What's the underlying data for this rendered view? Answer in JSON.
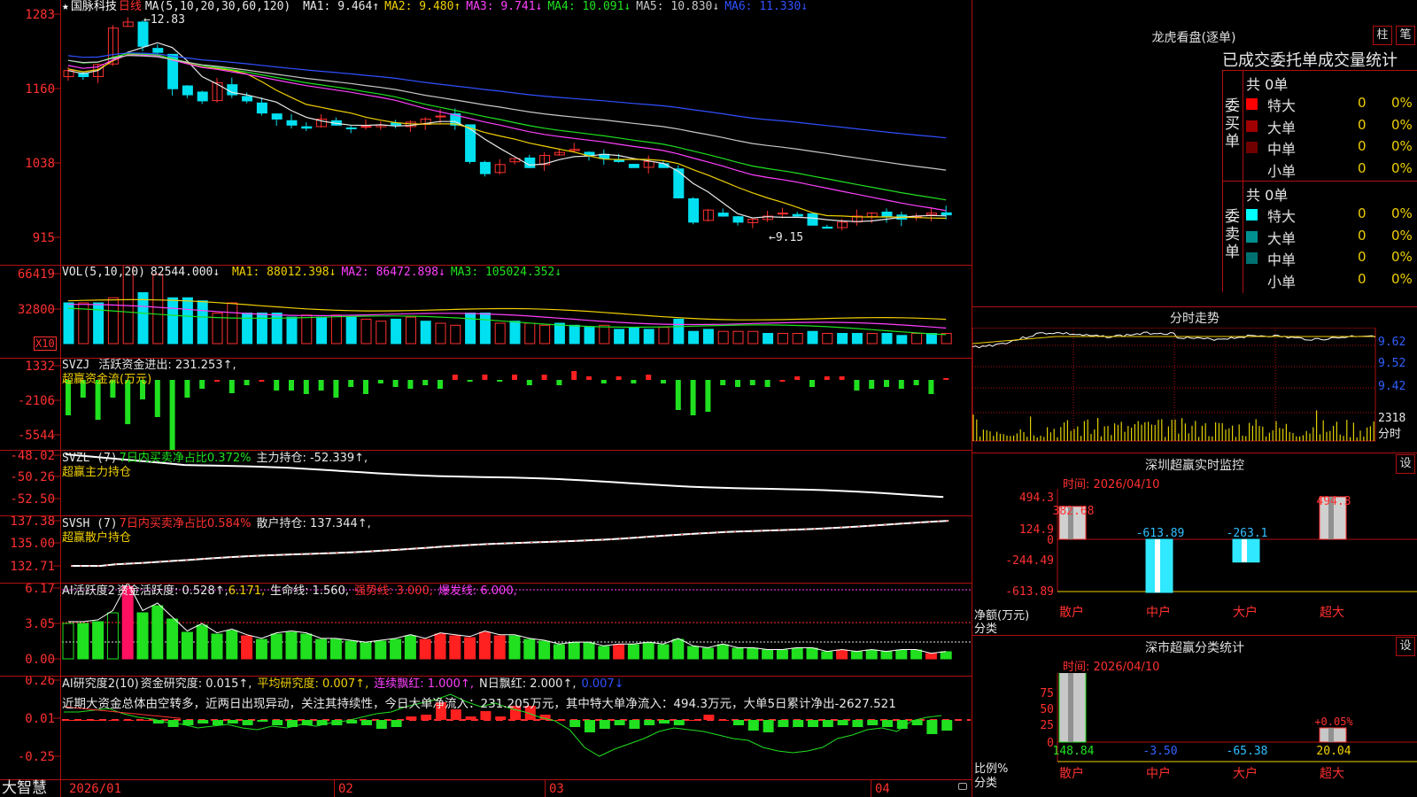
{
  "stock": {
    "star": "★",
    "name": "国脉科技",
    "period": "日线",
    "ma_label": "MA(5,10,20,30,60,120)",
    "ma": [
      {
        "text": "MA1: 9.464↑",
        "color": "#e8e8e8"
      },
      {
        "text": "MA2: 9.480↑",
        "color": "#f0d000"
      },
      {
        "text": "MA3: 9.741↓",
        "color": "#ff40ff"
      },
      {
        "text": "MA4: 10.091↓",
        "color": "#20e020"
      },
      {
        "text": "MA5: 10.830↓",
        "color": "#c8c8c8"
      },
      {
        "text": "MA6: 11.330↓",
        "color": "#3050ff"
      }
    ],
    "high_mark": "←12.83",
    "low_mark": "←9.15",
    "y_labels": [
      "1283",
      "1160",
      "1038",
      "915"
    ]
  },
  "vol": {
    "label": "VOL(5,10,20)",
    "value": "82544.000↓",
    "ma": [
      {
        "text": "MA1: 88012.398↓",
        "color": "#f0d000"
      },
      {
        "text": "MA2: 86472.898↓",
        "color": "#ff40ff"
      },
      {
        "text": "MA3: 105024.352↓",
        "color": "#20e020"
      }
    ],
    "y_labels": [
      "66419",
      "32800"
    ],
    "unit": "X10"
  },
  "svzj": {
    "label": "SVZJ",
    "text1": "活跃资金进出: 231.253↑,",
    "text2": "超赢资金流(万元)",
    "y_labels": [
      "1332",
      "-2106",
      "-5544"
    ]
  },
  "svzl": {
    "label": "SVZL (7)",
    "text1": "7日内买卖净占比0.372%",
    "text2": "主力持仓: -52.339↑,",
    "text3": "超赢主力持仓",
    "y_labels": [
      "-48.02",
      "-50.26",
      "-52.50"
    ]
  },
  "svsh": {
    "label": "SVSH (7)",
    "text1": "7日内买卖净占比0.584%",
    "text2": "散户持仓: 137.344↑,",
    "text3": "超赢散户持仓",
    "y_labels": [
      "137.38",
      "135.00",
      "132.71"
    ]
  },
  "ai1": {
    "label": "AI活跃度2",
    "text1": "资金活跃度: 0.528↑,",
    "text2": "6.171,",
    "text3": "生命线: 1.560,",
    "text4": "强势线: 3.000,",
    "text5": "爆发线: 6.000,",
    "y_labels": [
      "6.17",
      "3.05",
      "0.00"
    ]
  },
  "ai2": {
    "label": "AI研究度2(10)",
    "text1": "资金研究度: 0.015↑,",
    "text2": "平均研究度: 0.007↑,",
    "text3": "连续飘红: 1.000↑,",
    "text4": "N日飘红: 2.000↑,",
    "text5": "0.007↓",
    "comment": "近期大资金总体由空转多，近两日出现异动，关注其持续性，今日大单净流入：231.205万元，其中特大单净流入：494.3万元，大单5日累计净出-2627.521",
    "y_labels": [
      "0.26",
      "0.01",
      "-0.25"
    ]
  },
  "xaxis": {
    "brand": "大智慧",
    "dates": [
      "2026/01",
      "02",
      "03",
      "04"
    ]
  },
  "lhb": {
    "title": "龙虎看盘(逐单)",
    "btn1": "柱",
    "btn2": "笔",
    "subtitle": "已成交委托单成交量统计",
    "buy_label": "委买单",
    "sell_label": "委卖单",
    "buy_total": "共 0单",
    "sell_total": "共 0单",
    "buy_rows": [
      {
        "name": "特大",
        "count": "0",
        "pct": "0%",
        "color": "#ff0000"
      },
      {
        "name": "大单",
        "count": "0",
        "pct": "0%",
        "color": "#a00000"
      },
      {
        "name": "中单",
        "count": "0",
        "pct": "0%",
        "color": "#700000"
      },
      {
        "name": "小单",
        "count": "0",
        "pct": "0%",
        "color": "#000000"
      }
    ],
    "sell_rows": [
      {
        "name": "特大",
        "count": "0",
        "pct": "0%",
        "color": "#00ffff"
      },
      {
        "name": "大单",
        "count": "0",
        "pct": "0%",
        "color": "#009090"
      },
      {
        "name": "中单",
        "count": "0",
        "pct": "0%",
        "color": "#007070"
      },
      {
        "name": "小单",
        "count": "0",
        "pct": "0%",
        "color": "#000000"
      }
    ]
  },
  "intraday": {
    "title": "分时走势",
    "y_labels": [
      "9.62",
      "9.52",
      "9.42",
      "2318"
    ],
    "unit": "分时"
  },
  "monitor": {
    "title": "深圳超赢实时监控",
    "set": "设",
    "time": "时间: 2026/04/10",
    "y_labels": [
      "494.3",
      "124.9",
      "0",
      "-244.49",
      "-613.89"
    ],
    "axis_label1": "净额(万元)",
    "axis_label2": "分类",
    "categories": [
      "散户",
      "中户",
      "大户",
      "超大"
    ],
    "values": [
      382.68,
      -613.89,
      -263.1,
      494.3
    ],
    "value_labels": [
      "382.68",
      "-613.89",
      "-263.1",
      "494.3"
    ]
  },
  "classify": {
    "title": "深市超赢分类统计",
    "set": "设",
    "time": "时间: 2026/04/10",
    "y_labels": [
      "75",
      "50",
      "25",
      "0"
    ],
    "axis_label1": "比例%",
    "axis_label2": "分类",
    "categories": [
      "散户",
      "中户",
      "大户",
      "超大"
    ],
    "values": [
      148.84,
      -3.5,
      -65.38,
      20.04
    ],
    "value_labels": [
      "148.84",
      "-3.50",
      "-65.38",
      "20.04"
    ],
    "extra_label": "+0.05%"
  }
}
